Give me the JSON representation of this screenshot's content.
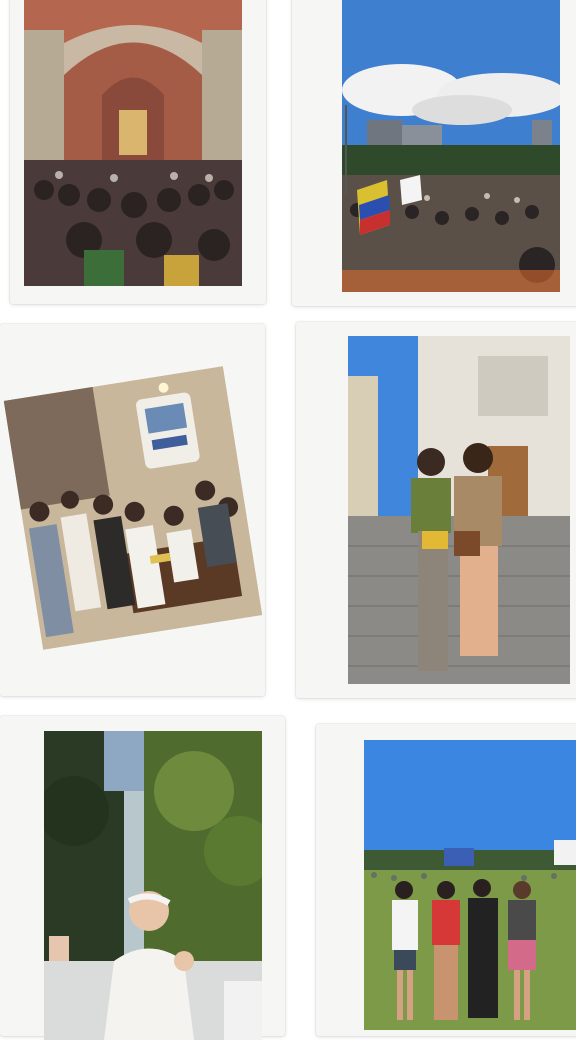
{
  "collage": {
    "photos": [
      {
        "subject": "cathedral-crowd"
      },
      {
        "subject": "rally-flags"
      },
      {
        "subject": "restaurant-group"
      },
      {
        "subject": "street-portrait"
      },
      {
        "subject": "pope-greeting"
      },
      {
        "subject": "field-group"
      }
    ]
  },
  "colors": {
    "background": "#ffffff",
    "frame": "#f6f6f4",
    "sky": "#3f7fd0",
    "vault": "#b5664f",
    "grass": "#7c9a48"
  }
}
